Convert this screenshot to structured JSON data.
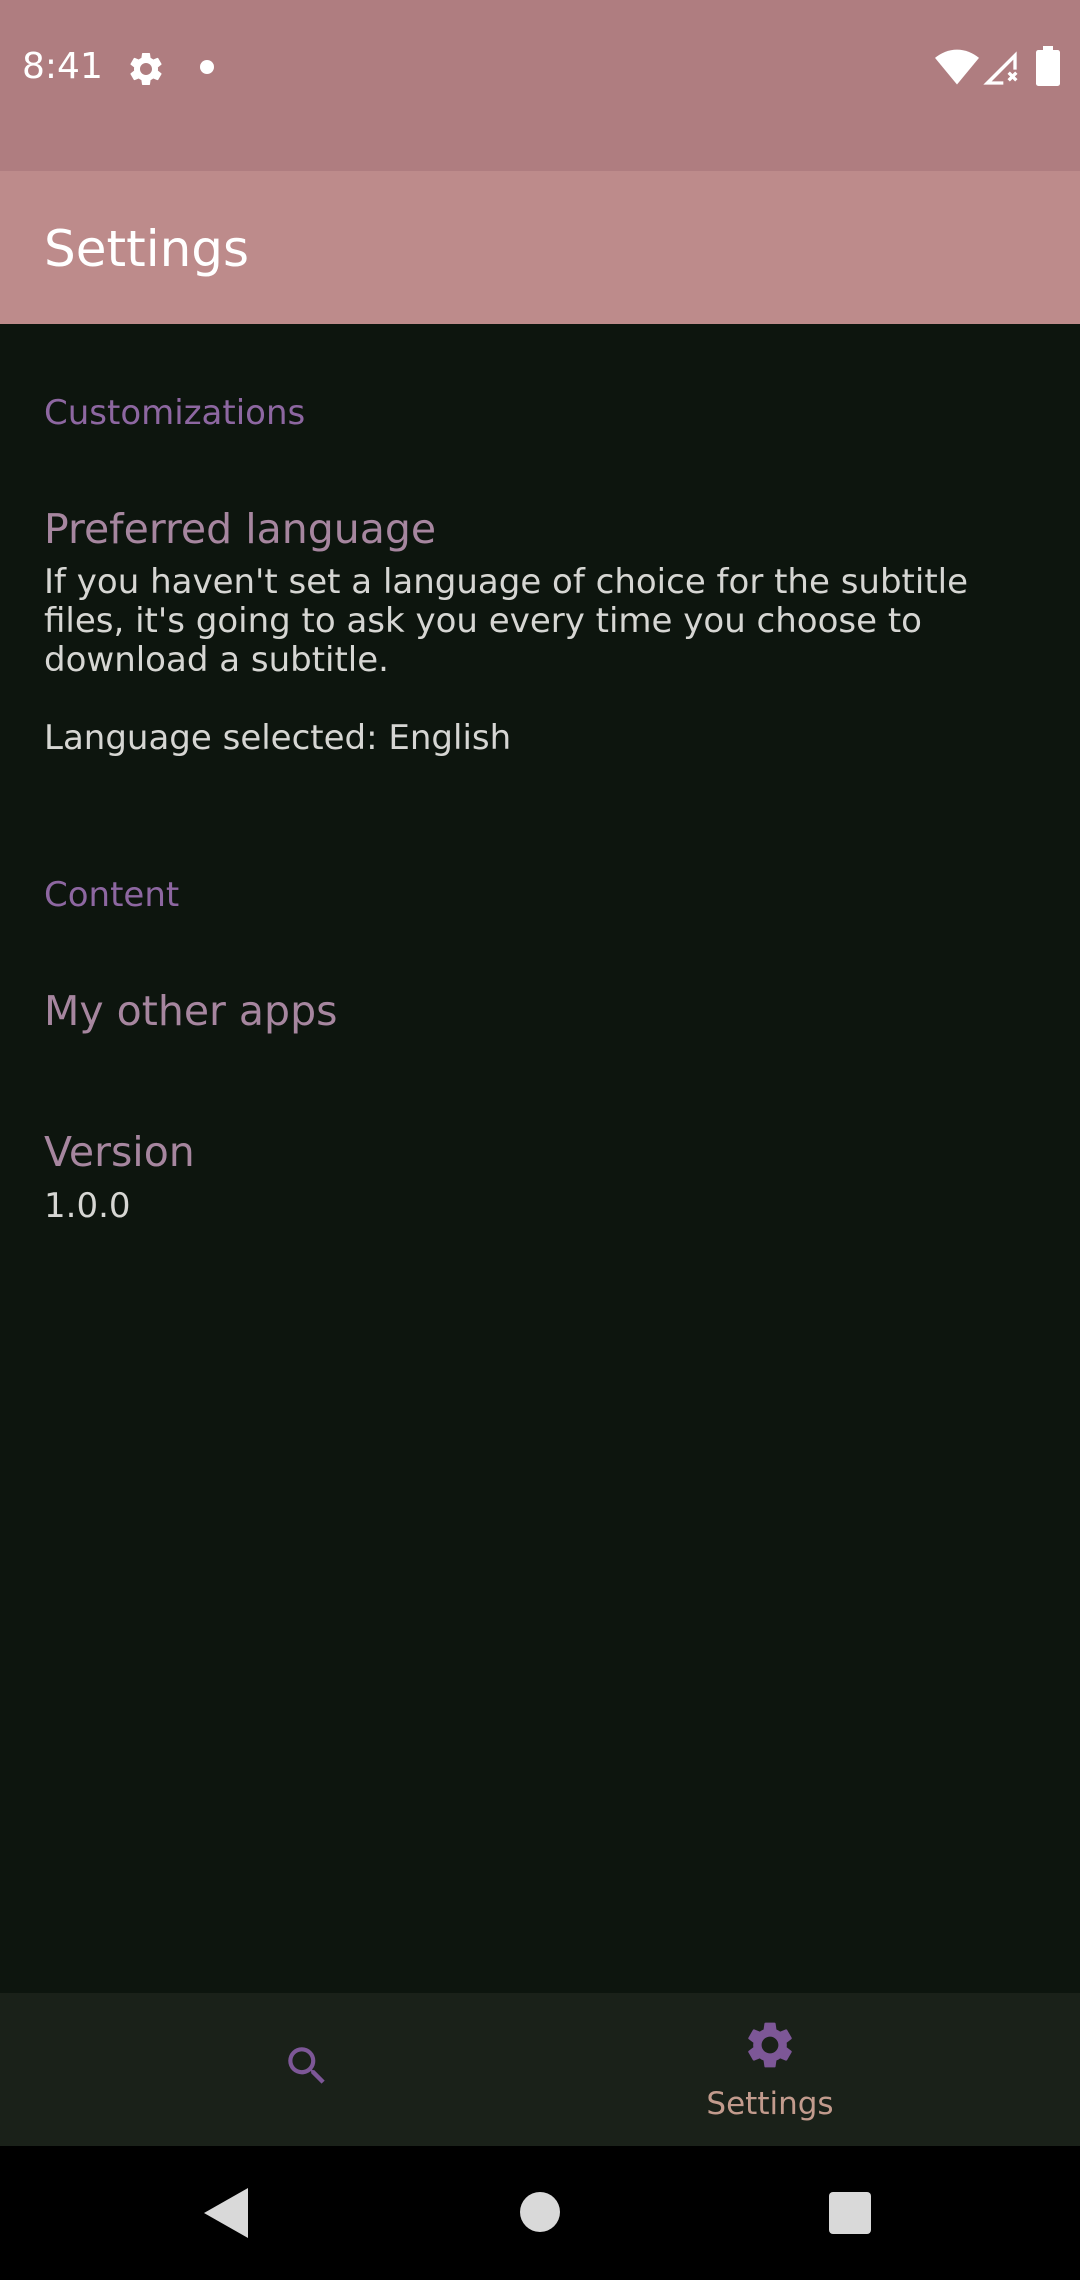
{
  "status_bar": {
    "time": "8:41",
    "icons": [
      "gear-icon",
      "dot-icon",
      "wifi-icon",
      "signal-icon",
      "battery-icon"
    ]
  },
  "app_bar": {
    "title": "Settings"
  },
  "sections": {
    "customizations": {
      "header": "Customizations",
      "preferred_language": {
        "title": "Preferred language",
        "summary": "If you haven't set a language of choice for the subtitle files, it's going to ask you every time you choose to download a subtitle.",
        "selected": "Language selected: English"
      }
    },
    "content": {
      "header": "Content",
      "other_apps": {
        "title": "My other apps"
      },
      "version": {
        "title": "Version",
        "value": "1.0.0"
      }
    }
  },
  "bottom_nav": {
    "items": [
      {
        "icon": "search-icon",
        "label": ""
      },
      {
        "icon": "settings-icon",
        "label": "Settings"
      }
    ],
    "selected_index": 1
  },
  "colors": {
    "status_bar": "#af7d80",
    "app_bar": "#bd8b8b",
    "background": "#0d150e",
    "section_header": "#8d67a1",
    "pref_title": "#a6869f",
    "pref_summary": "#d6d6d3",
    "bottom_nav": "#1a2119",
    "nav_active_icon": "#7d5797",
    "nav_active_label": "#c29b8d"
  }
}
